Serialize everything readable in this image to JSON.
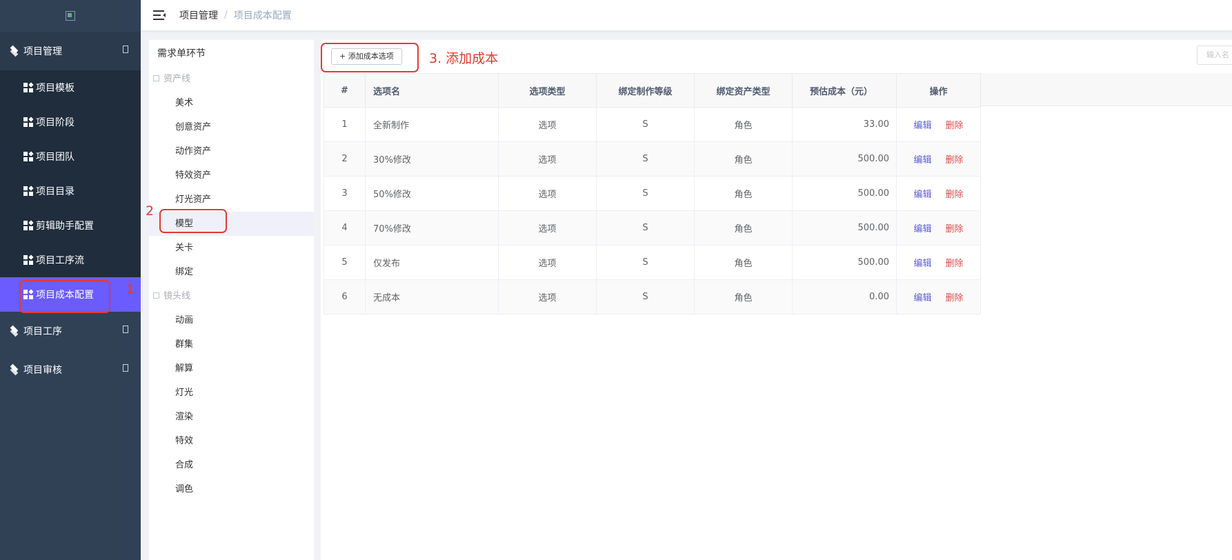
{
  "sidebar": {
    "logo_icon": "broken-image-icon",
    "top_menu": {
      "label": "项目管理",
      "icon": "layers-icon",
      "expanded": true
    },
    "items": [
      {
        "label": "项目模板",
        "active": false
      },
      {
        "label": "项目阶段",
        "active": false
      },
      {
        "label": "项目团队",
        "active": false
      },
      {
        "label": "项目目录",
        "active": false
      },
      {
        "label": "剪辑助手配置",
        "active": false
      },
      {
        "label": "项目工序流",
        "active": false
      },
      {
        "label": "项目成本配置",
        "active": true
      }
    ],
    "groups": [
      {
        "label": "项目工序",
        "icon": "layers-icon"
      },
      {
        "label": "项目审核",
        "icon": "layers-icon"
      }
    ]
  },
  "header": {
    "breadcrumb_root": "项目管理",
    "breadcrumb_sep": "/",
    "breadcrumb_current": "项目成本配置"
  },
  "tree": {
    "title": "需求单环节",
    "groups": [
      {
        "label": "资产线",
        "children": [
          "美术",
          "创意资产",
          "动作资产",
          "特效资产",
          "灯光资产",
          "模型",
          "关卡",
          "绑定"
        ]
      },
      {
        "label": "镜头线",
        "children": [
          "动画",
          "群集",
          "解算",
          "灯光",
          "渲染",
          "特效",
          "合成",
          "调色"
        ]
      }
    ],
    "selected": "模型"
  },
  "toolbar": {
    "add_button": "+ 添加成本选项",
    "search_placeholder": "输入名"
  },
  "table": {
    "columns": [
      "#",
      "选项名",
      "选项类型",
      "绑定制作等级",
      "绑定资产类型",
      "预估成本（元）",
      "操作"
    ],
    "rows": [
      {
        "idx": "1",
        "name": "全新制作",
        "type": "选项",
        "level": "S",
        "asset": "角色",
        "cost": "33.00"
      },
      {
        "idx": "2",
        "name": "30%修改",
        "type": "选项",
        "level": "S",
        "asset": "角色",
        "cost": "500.00"
      },
      {
        "idx": "3",
        "name": "50%修改",
        "type": "选项",
        "level": "S",
        "asset": "角色",
        "cost": "500.00"
      },
      {
        "idx": "4",
        "name": "70%修改",
        "type": "选项",
        "level": "S",
        "asset": "角色",
        "cost": "500.00"
      },
      {
        "idx": "5",
        "name": "仅发布",
        "type": "选项",
        "level": "S",
        "asset": "角色",
        "cost": "500.00"
      },
      {
        "idx": "6",
        "name": "无成本",
        "type": "选项",
        "level": "S",
        "asset": "角色",
        "cost": "0.00"
      }
    ],
    "edit_label": "编辑",
    "delete_label": "删除"
  },
  "annotations": {
    "step1": "1",
    "step2": "2",
    "step3": "3. 添加成本",
    "color": "#e33b2e"
  },
  "colors": {
    "sidebar_bg": "#304156",
    "active_item": "#6a5cff",
    "edit_link": "#5b5bd6",
    "delete_link": "#e34d4d"
  }
}
